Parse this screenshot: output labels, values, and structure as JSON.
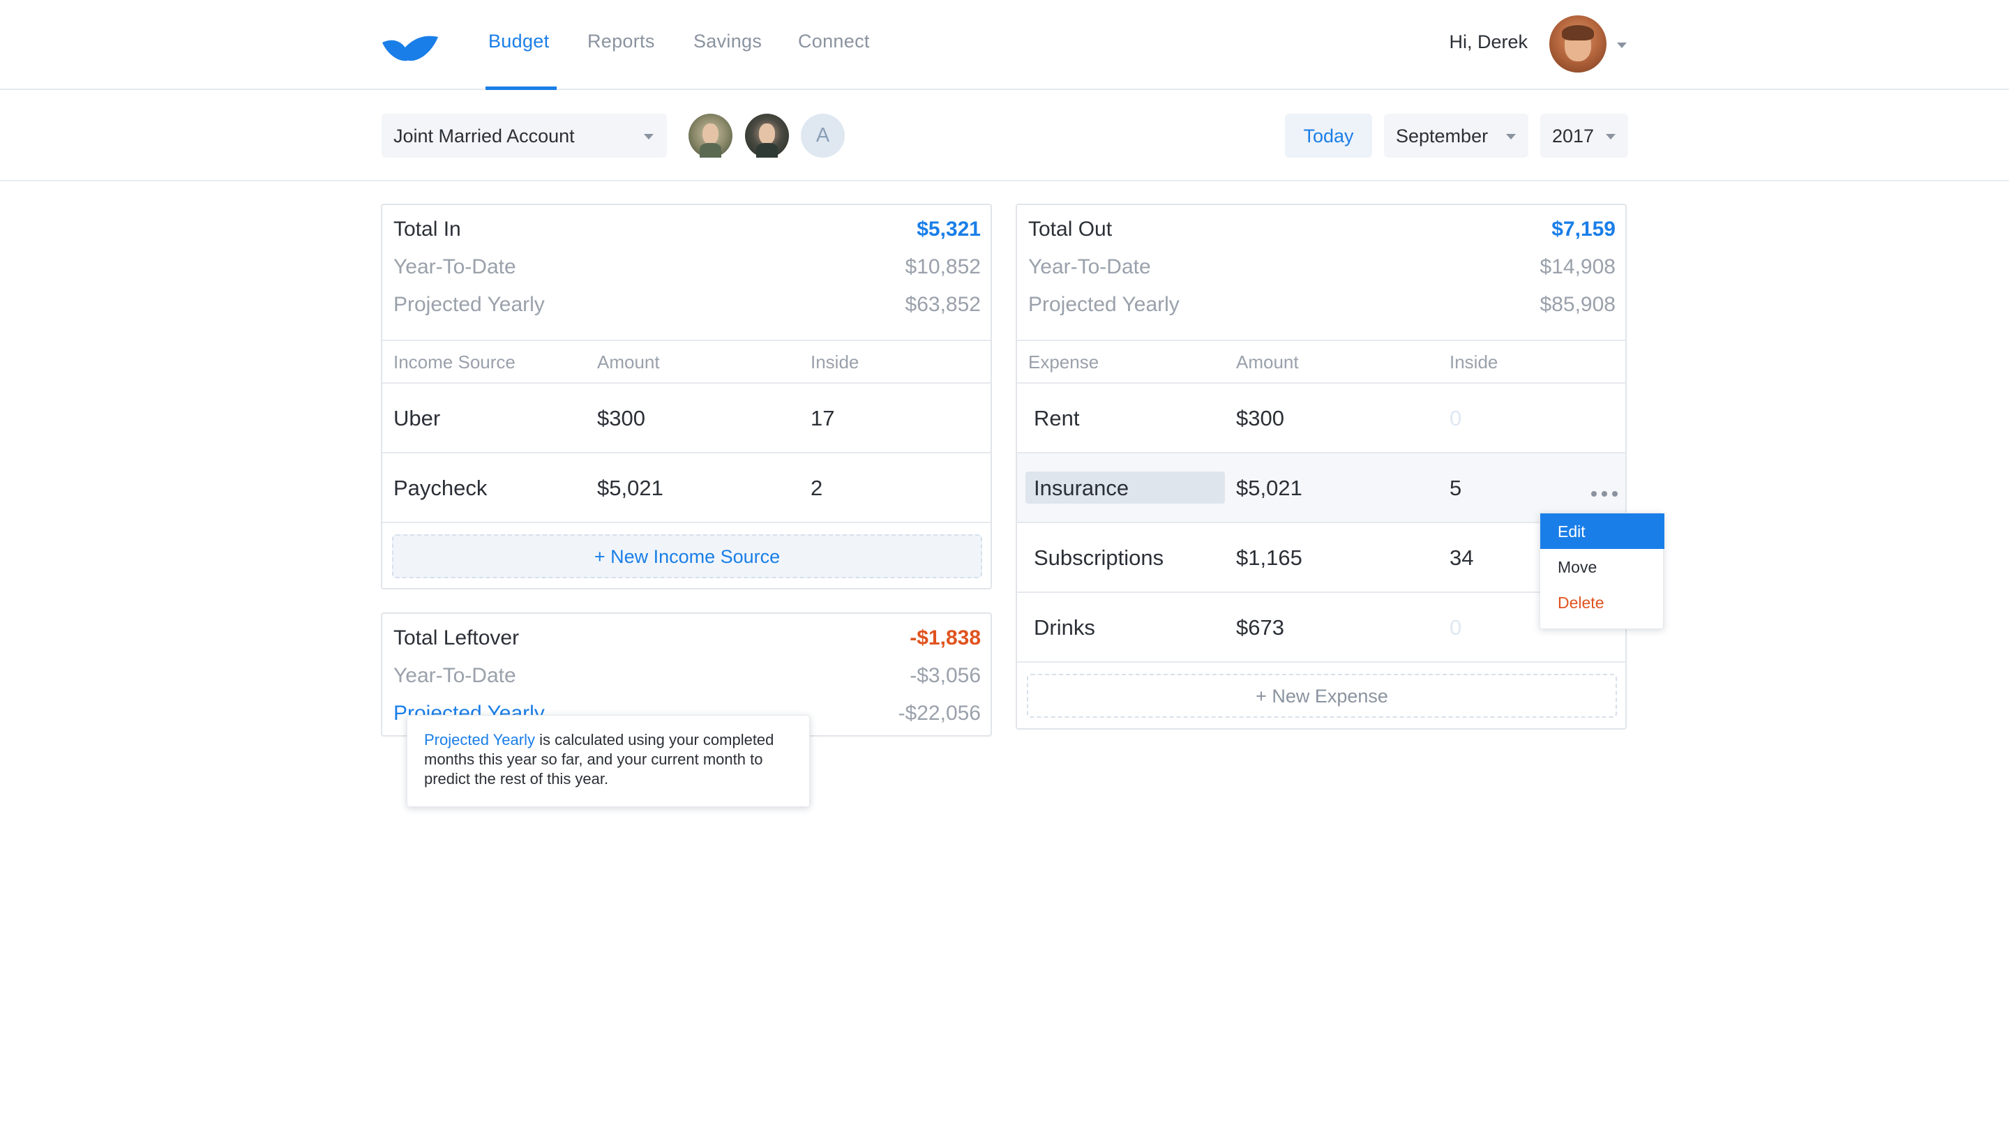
{
  "nav": {
    "tabs": [
      "Budget",
      "Reports",
      "Savings",
      "Connect"
    ],
    "active_tab": "Budget",
    "greeting": "Hi, Derek"
  },
  "toolbar": {
    "account": "Joint Married Account",
    "add_member_initial": "A",
    "today_label": "Today",
    "month": "September",
    "year": "2017"
  },
  "income": {
    "total_label": "Total In",
    "total_value": "$5,321",
    "ytd_label": "Year-To-Date",
    "ytd_value": "$10,852",
    "projected_label": "Projected Yearly",
    "projected_value": "$63,852",
    "columns": [
      "Income Source",
      "Amount",
      "Inside"
    ],
    "rows": [
      {
        "name": "Uber",
        "amount": "$300",
        "inside": "17"
      },
      {
        "name": "Paycheck",
        "amount": "$5,021",
        "inside": "2"
      }
    ],
    "new_label": "+ New Income Source"
  },
  "leftover": {
    "total_label": "Total Leftover",
    "total_value": "-$1,838",
    "ytd_label": "Year-To-Date",
    "ytd_value": "-$3,056",
    "projected_label": "Projected Yearly",
    "projected_value": "-$22,056"
  },
  "expenses": {
    "total_label": "Total Out",
    "total_value": "$7,159",
    "ytd_label": "Year-To-Date",
    "ytd_value": "$14,908",
    "projected_label": "Projected Yearly",
    "projected_value": "$85,908",
    "columns": [
      "Expense",
      "Amount",
      "Inside"
    ],
    "rows": [
      {
        "name": "Rent",
        "amount": "$300",
        "inside": "0"
      },
      {
        "name": "Insurance",
        "amount": "$5,021",
        "inside": "5"
      },
      {
        "name": "Subscriptions",
        "amount": "$1,165",
        "inside": "34"
      },
      {
        "name": "Drinks",
        "amount": "$673",
        "inside": "0"
      }
    ],
    "new_label": "+ New Expense"
  },
  "row_menu": {
    "items": [
      "Edit",
      "Move",
      "Delete"
    ],
    "selected": "Edit"
  },
  "tooltip": {
    "term": "Projected Yearly",
    "text": " is calculated using your completed months this year so far, and your current month to predict the rest of this year."
  },
  "colors": {
    "accent": "#1a7ee8",
    "negative": "#e0531f",
    "muted": "#9aa1ab"
  }
}
